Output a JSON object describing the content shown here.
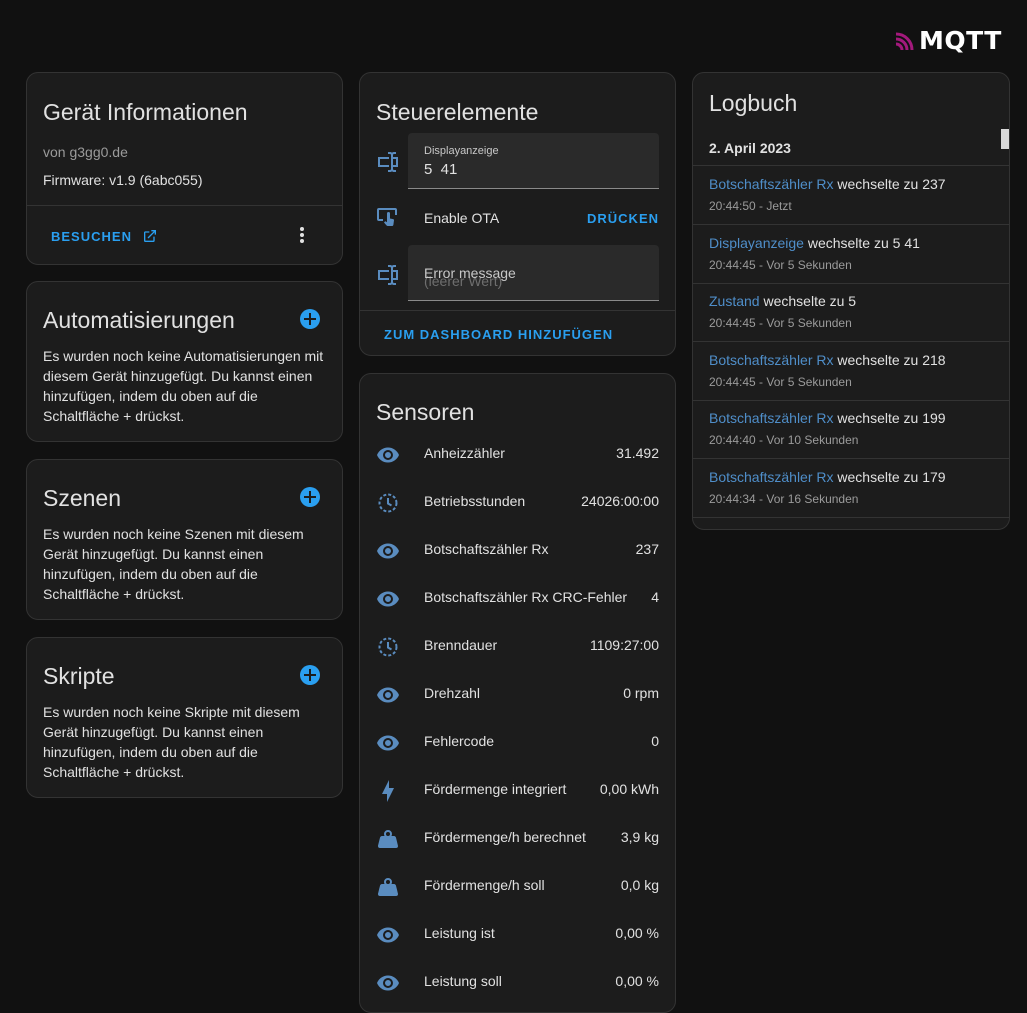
{
  "brand": {
    "logo_text": "MQTT",
    "accent": "#2a9ff0",
    "logo_color": "#a3197c"
  },
  "device_info": {
    "title": "Gerät Informationen",
    "manufacturer": "von g3gg0.de",
    "firmware": "Firmware: v1.9 (6abc055)",
    "visit_label": "BESUCHEN"
  },
  "automations": {
    "title": "Automatisierungen",
    "text": "Es wurden noch keine Automatisierungen mit diesem Gerät hinzugefügt. Du kannst einen hinzufügen, indem du oben auf die Schaltfläche + drückst."
  },
  "scenes": {
    "title": "Szenen",
    "text": "Es wurden noch keine Szenen mit diesem Gerät hinzugefügt. Du kannst einen hinzufügen, indem du oben auf die Schaltfläche + drückst."
  },
  "scripts": {
    "title": "Skripte",
    "text": "Es wurden noch keine Skripte mit diesem Gerät hinzugefügt. Du kannst einen hinzufügen, indem du oben auf die Schaltfläche + drückst."
  },
  "controls": {
    "title": "Steuerelemente",
    "display_label": "Displayanzeige",
    "display_value": "5  41",
    "ota_label": "Enable OTA",
    "ota_button": "DRÜCKEN",
    "error_label": "Error message",
    "error_placeholder": "(leerer Wert)",
    "add_dashboard": "ZUM DASHBOARD HINZUFÜGEN"
  },
  "sensors": {
    "title": "Sensoren",
    "items": [
      {
        "icon": "eye-icon",
        "name": "Anheizzähler",
        "value": "31.492"
      },
      {
        "icon": "clock-icon",
        "name": "Betriebsstunden",
        "value": "24026:00:00"
      },
      {
        "icon": "eye-icon",
        "name": "Botschaftszähler Rx",
        "value": "237"
      },
      {
        "icon": "eye-icon",
        "name": "Botschaftszähler Rx CRC-Fehler",
        "value": "4"
      },
      {
        "icon": "clock-icon",
        "name": "Brenndauer",
        "value": "1109:27:00"
      },
      {
        "icon": "eye-icon",
        "name": "Drehzahl",
        "value": "0 rpm"
      },
      {
        "icon": "eye-icon",
        "name": "Fehlercode",
        "value": "0"
      },
      {
        "icon": "lightning-icon",
        "name": "Fördermenge integriert",
        "value": "0,00 kWh"
      },
      {
        "icon": "weight-icon",
        "name": "Fördermenge/h berechnet",
        "value": "3,9 kg"
      },
      {
        "icon": "weight-icon",
        "name": "Fördermenge/h soll",
        "value": "0,0 kg"
      },
      {
        "icon": "eye-icon",
        "name": "Leistung ist",
        "value": "0,00 %"
      },
      {
        "icon": "eye-icon",
        "name": "Leistung soll",
        "value": "0,00 %"
      }
    ]
  },
  "logbook": {
    "title": "Logbuch",
    "date": "2. April 2023",
    "entries": [
      {
        "entity": "Botschaftszähler Rx",
        "text": " wechselte zu 237",
        "time": "20:44:50 - Jetzt"
      },
      {
        "entity": "Displayanzeige",
        "text": " wechselte zu 5 41",
        "time": "20:44:45 - Vor 5 Sekunden"
      },
      {
        "entity": "Zustand",
        "text": " wechselte zu 5",
        "time": "20:44:45 - Vor 5 Sekunden"
      },
      {
        "entity": "Botschaftszähler Rx",
        "text": " wechselte zu 218",
        "time": "20:44:45 - Vor 5 Sekunden"
      },
      {
        "entity": "Botschaftszähler Rx",
        "text": " wechselte zu 199",
        "time": "20:44:40 - Vor 10 Sekunden"
      },
      {
        "entity": "Botschaftszähler Rx",
        "text": " wechselte zu 179",
        "time": "20:44:34 - Vor 16 Sekunden"
      }
    ]
  }
}
